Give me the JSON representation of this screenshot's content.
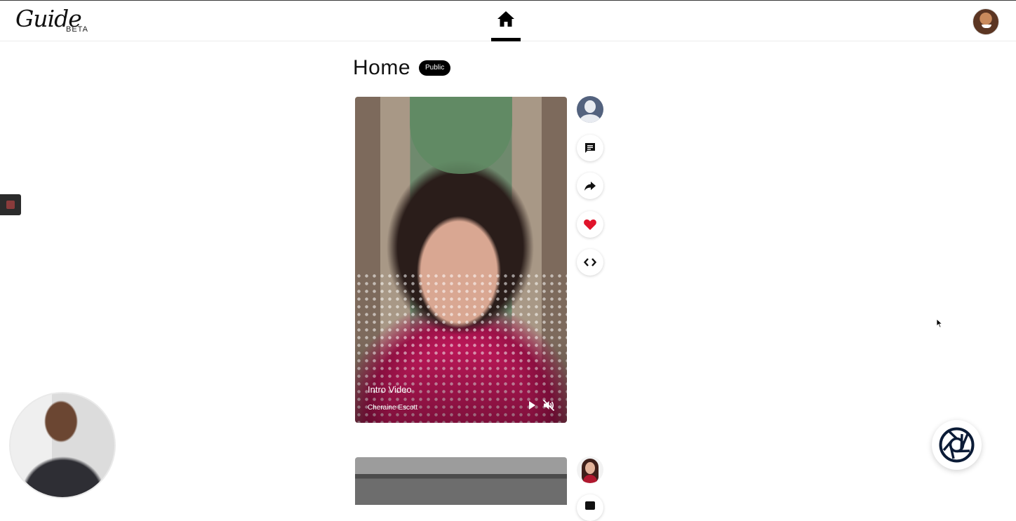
{
  "header": {
    "logo_text": "Guide",
    "beta_label": "BETA",
    "nav_icon": "home-icon"
  },
  "page": {
    "title": "Home",
    "visibility_badge": "Public"
  },
  "feed": [
    {
      "title": "Intro Video",
      "author": "Cheraine Escott",
      "controls": [
        "play-icon",
        "muted-speaker-icon"
      ]
    }
  ],
  "actions": [
    "comment-icon",
    "share-icon",
    "heart-icon",
    "embed-code-icon"
  ],
  "colors": {
    "accent": "#000000",
    "like": "#e0142b",
    "capture": "#0b1b36"
  }
}
